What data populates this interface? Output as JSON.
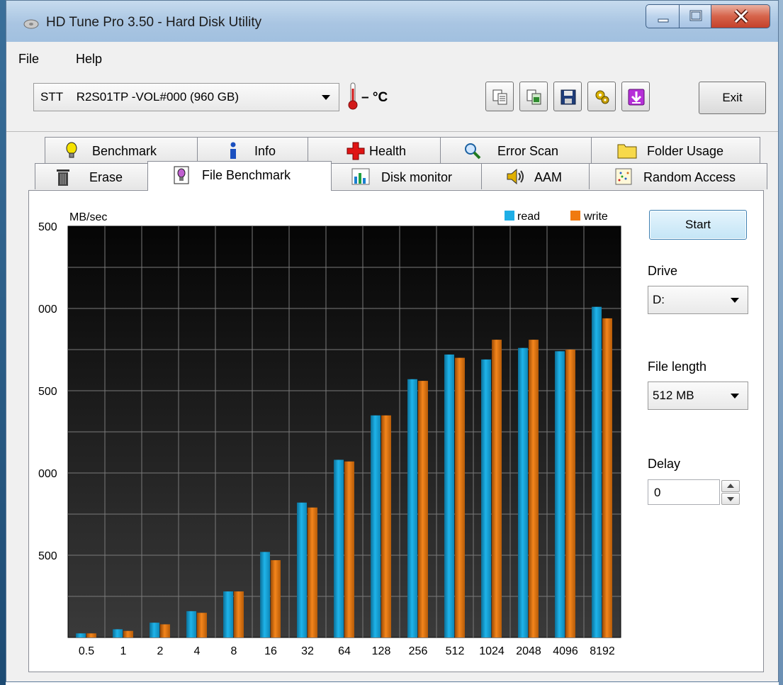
{
  "window": {
    "title": "HD Tune Pro 3.50 - Hard Disk Utility"
  },
  "menu": [
    {
      "label": "File"
    },
    {
      "label": "Help"
    }
  ],
  "toolbar": {
    "drive": "STT    R2S01TP -VOL#000 (960 GB)",
    "temperature": "– °C",
    "buttons": [
      {
        "icon": "copy-text-icon"
      },
      {
        "icon": "copy-screenshot-icon"
      },
      {
        "icon": "save-icon"
      },
      {
        "icon": "options-icon"
      },
      {
        "icon": "download-arrow-icon"
      }
    ],
    "exit_label": "Exit"
  },
  "tabs_row1": [
    {
      "label": "Benchmark",
      "icon": "lightbulb-icon"
    },
    {
      "label": "Info",
      "icon": "info-icon"
    },
    {
      "label": "Health",
      "icon": "health-cross-icon"
    },
    {
      "label": "Error Scan",
      "icon": "magnifier-icon"
    },
    {
      "label": "Folder Usage",
      "icon": "folder-icon"
    }
  ],
  "tabs_row2": [
    {
      "label": "Erase",
      "icon": "trash-icon"
    },
    {
      "label": "File Benchmark",
      "icon": "file-bulb-icon",
      "active": true
    },
    {
      "label": "Disk monitor",
      "icon": "bar-chart-icon"
    },
    {
      "label": "AAM",
      "icon": "speaker-icon"
    },
    {
      "label": "Random Access",
      "icon": "scatter-icon"
    }
  ],
  "controls": {
    "start_label": "Start",
    "drive_label": "Drive",
    "drive_value": "D:",
    "file_length_label": "File length",
    "file_length_value": "512 MB",
    "delay_label": "Delay",
    "delay_value": "0"
  },
  "chart_data": {
    "type": "bar",
    "ylabel": "MB/sec",
    "y_tick_labels": [
      "500",
      "000",
      "500",
      "000",
      "500"
    ],
    "ylim": [
      0,
      2500
    ],
    "y_ticks": [
      500,
      1000,
      1500,
      2000,
      2500
    ],
    "grid": true,
    "legend_position": "top-right",
    "categories": [
      "0.5",
      "1",
      "2",
      "4",
      "8",
      "16",
      "32",
      "64",
      "128",
      "256",
      "512",
      "1024",
      "2048",
      "4096",
      "8192"
    ],
    "series": [
      {
        "name": "read",
        "color": "#1eaee6",
        "values": [
          25,
          50,
          90,
          160,
          280,
          520,
          820,
          1080,
          1350,
          1570,
          1720,
          1690,
          1760,
          1740,
          2010
        ]
      },
      {
        "name": "write",
        "color": "#f07a10",
        "values": [
          25,
          40,
          80,
          150,
          280,
          470,
          790,
          1070,
          1350,
          1560,
          1700,
          1810,
          1810,
          1750,
          1940
        ]
      }
    ]
  }
}
